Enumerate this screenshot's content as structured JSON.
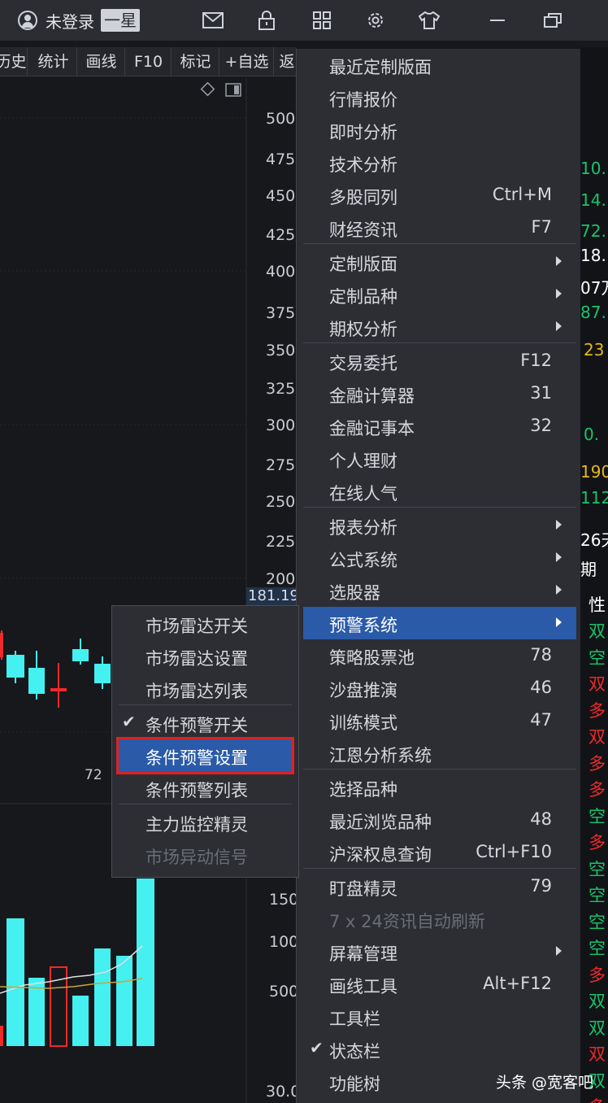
{
  "titlebar": {
    "login_status": "未登录",
    "star_badge": "一星",
    "icons": [
      "mail-icon",
      "lock-icon",
      "grid-icon",
      "gear-icon",
      "shirt-icon",
      "minimize-icon",
      "restore-icon"
    ]
  },
  "toolbar": {
    "items": [
      "历史",
      "统计",
      "画线",
      "F10",
      "标记",
      "+自选",
      "返"
    ]
  },
  "chart": {
    "price_labels": [
      "500",
      "475",
      "450",
      "425",
      "400",
      "375",
      "350",
      "325",
      "300",
      "275",
      "250",
      "225",
      "200"
    ],
    "current_price": "181.19",
    "volume_labels": [
      "150",
      "100",
      "500"
    ],
    "bottom_label": "30.0",
    "annotation": "72",
    "colors": {
      "up": "#ee2a2a",
      "down": "#44f0f0",
      "bg": "#17181c"
    }
  },
  "right_panel": {
    "values": [
      {
        "text": "10.",
        "color": "green"
      },
      {
        "text": "14.",
        "color": "green"
      },
      {
        "text": "72.",
        "color": "green"
      },
      {
        "text": "18.",
        "color": "white"
      },
      {
        "text": "07万",
        "color": "white"
      },
      {
        "text": "87.",
        "color": "green"
      },
      {
        "text": "23",
        "color": "yellow"
      },
      {
        "text": "0.",
        "color": "green"
      },
      {
        "text": "190",
        "color": "yellow"
      },
      {
        "text": "112",
        "color": "green"
      },
      {
        "text": "26天",
        "color": "white"
      },
      {
        "text": "期",
        "color": "white"
      }
    ],
    "header": "性",
    "rows": [
      {
        "text": "双",
        "color": "green"
      },
      {
        "text": "空",
        "color": "green"
      },
      {
        "text": "双",
        "color": "red"
      },
      {
        "text": "多",
        "color": "red"
      },
      {
        "text": "双",
        "color": "red"
      },
      {
        "text": "多",
        "color": "red"
      },
      {
        "text": "多",
        "color": "red"
      },
      {
        "text": "空",
        "color": "green"
      },
      {
        "text": "多",
        "color": "red"
      },
      {
        "text": "空",
        "color": "green"
      },
      {
        "text": "空",
        "color": "green"
      },
      {
        "text": "空",
        "color": "green"
      },
      {
        "text": "空",
        "color": "green"
      },
      {
        "text": "多",
        "color": "red"
      },
      {
        "text": "双",
        "color": "green"
      },
      {
        "text": "双",
        "color": "green"
      },
      {
        "text": "双",
        "color": "red"
      },
      {
        "text": "双",
        "color": "green"
      },
      {
        "text": "多",
        "color": "red"
      }
    ]
  },
  "menu": {
    "items": [
      {
        "label": "最近定制版面",
        "shortcut": "",
        "arrow": false
      },
      {
        "label": "行情报价",
        "shortcut": "",
        "arrow": false
      },
      {
        "label": "即时分析",
        "shortcut": "",
        "arrow": false
      },
      {
        "label": "技术分析",
        "shortcut": "",
        "arrow": false
      },
      {
        "label": "多股同列",
        "shortcut": "Ctrl+M",
        "arrow": false
      },
      {
        "label": "财经资讯",
        "shortcut": "F7",
        "arrow": false
      },
      {
        "label": "定制版面",
        "shortcut": "",
        "arrow": true
      },
      {
        "label": "定制品种",
        "shortcut": "",
        "arrow": true
      },
      {
        "label": "期权分析",
        "shortcut": "",
        "arrow": true
      },
      {
        "label": "交易委托",
        "shortcut": "F12",
        "arrow": false
      },
      {
        "label": "金融计算器",
        "shortcut": "31",
        "arrow": false
      },
      {
        "label": "金融记事本",
        "shortcut": "32",
        "arrow": false
      },
      {
        "label": "个人理财",
        "shortcut": "",
        "arrow": false
      },
      {
        "label": "在线人气",
        "shortcut": "",
        "arrow": false
      },
      {
        "label": "报表分析",
        "shortcut": "",
        "arrow": true
      },
      {
        "label": "公式系统",
        "shortcut": "",
        "arrow": true
      },
      {
        "label": "选股器",
        "shortcut": "",
        "arrow": true
      },
      {
        "label": "预警系统",
        "shortcut": "",
        "arrow": true
      },
      {
        "label": "策略股票池",
        "shortcut": "78",
        "arrow": false
      },
      {
        "label": "沙盘推演",
        "shortcut": "46",
        "arrow": false
      },
      {
        "label": "训练模式",
        "shortcut": "47",
        "arrow": false
      },
      {
        "label": "江恩分析系统",
        "shortcut": "",
        "arrow": false
      },
      {
        "label": "选择品种",
        "shortcut": "",
        "arrow": false
      },
      {
        "label": "最近浏览品种",
        "shortcut": "48",
        "arrow": false
      },
      {
        "label": "沪深权息查询",
        "shortcut": "Ctrl+F10",
        "arrow": false
      },
      {
        "label": "盯盘精灵",
        "shortcut": "79",
        "arrow": false
      },
      {
        "label": "7 x 24资讯自动刷新",
        "shortcut": "",
        "arrow": false
      },
      {
        "label": "屏幕管理",
        "shortcut": "",
        "arrow": true
      },
      {
        "label": "画线工具",
        "shortcut": "Alt+F12",
        "arrow": false
      },
      {
        "label": "工具栏",
        "shortcut": "",
        "arrow": false
      },
      {
        "label": "状态栏",
        "shortcut": "",
        "arrow": false
      },
      {
        "label": "功能树",
        "shortcut": "",
        "arrow": false
      }
    ]
  },
  "submenu": {
    "items": [
      {
        "label": "市场雷达开关"
      },
      {
        "label": "市场雷达设置"
      },
      {
        "label": "市场雷达列表"
      },
      {
        "label": "条件预警开关"
      },
      {
        "label": "条件预警设置"
      },
      {
        "label": "条件预警列表"
      },
      {
        "label": "主力监控精灵"
      },
      {
        "label": "市场异动信号"
      }
    ]
  },
  "watermark": "头条 @宽客吧"
}
